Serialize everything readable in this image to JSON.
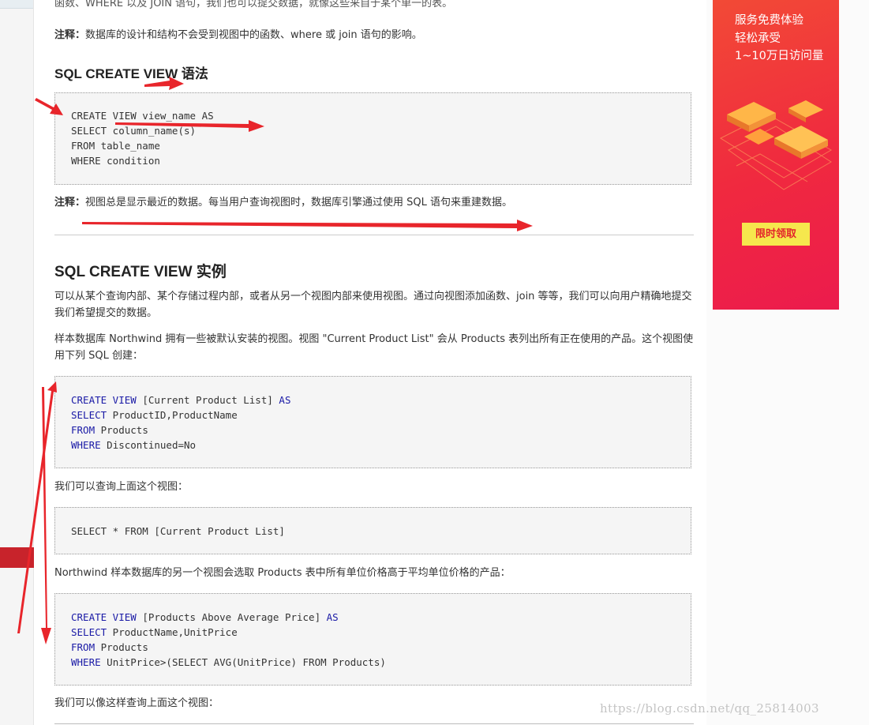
{
  "article": {
    "intro_cut": "函数、WHERE 以及 JOIN 语句，我们也可以提交数据，就像这些来自于某个单一的表。",
    "note1_label": "注释：",
    "note1_text": "数据库的设计和结构不会受到视图中的函数、where 或 join 语句的影响。",
    "syntax_heading": "SQL CREATE VIEW 语法",
    "syntax_code": [
      "CREATE VIEW view_name AS",
      "SELECT column_name(s)",
      "FROM table_name",
      "WHERE condition"
    ],
    "note2_label": "注释：",
    "note2_text": "视图总是显示最近的数据。每当用户查询视图时，数据库引擎通过使用 SQL 语句来重建数据。",
    "example_heading": "SQL CREATE VIEW 实例",
    "para1": "可以从某个查询内部、某个存储过程内部，或者从另一个视图内部来使用视图。通过向视图添加函数、join 等等，我们可以向用户精确地提交我们希望提交的数据。",
    "para2": "样本数据库 Northwind 拥有一些被默认安装的视图。视图 \"Current Product List\" 会从 Products 表列出所有正在使用的产品。这个视图使用下列 SQL 创建：",
    "code1": {
      "l1_kw": "CREATE VIEW",
      "l1_rest": " [Current Product List] ",
      "l1_kw2": "AS",
      "l2_kw": "SELECT",
      "l2_rest": " ProductID,ProductName",
      "l3_kw": "FROM",
      "l3_rest": " Products",
      "l4_kw": "WHERE",
      "l4_rest": " Discontinued=No"
    },
    "para3": "我们可以查询上面这个视图：",
    "code2": "SELECT * FROM [Current Product List]",
    "para4": "Northwind 样本数据库的另一个视图会选取 Products 表中所有单位价格高于平均单位价格的产品：",
    "code3": {
      "l1_kw": "CREATE VIEW",
      "l1_rest": " [Products Above Average Price] ",
      "l1_kw2": "AS",
      "l2_kw": "SELECT",
      "l2_rest": " ProductName,UnitPrice",
      "l3_kw": "FROM",
      "l3_rest": " Products",
      "l4_kw": "WHERE",
      "l4_rest": " UnitPrice>(SELECT AVG(UnitPrice) FROM Products)"
    },
    "para5": "我们可以像这样查询上面这个视图："
  },
  "ad": {
    "line1": "服务免费体验",
    "line2": "轻松承受",
    "line3": "1~10万日访问量",
    "button": "限时领取"
  },
  "watermark": "https://blog.csdn.net/qq_25814003",
  "colors": {
    "keyword": "#1a1aa6",
    "annotation_arrow": "#e8252b",
    "ad_bg": "#f0293f",
    "ad_button": "#f6e74d"
  }
}
